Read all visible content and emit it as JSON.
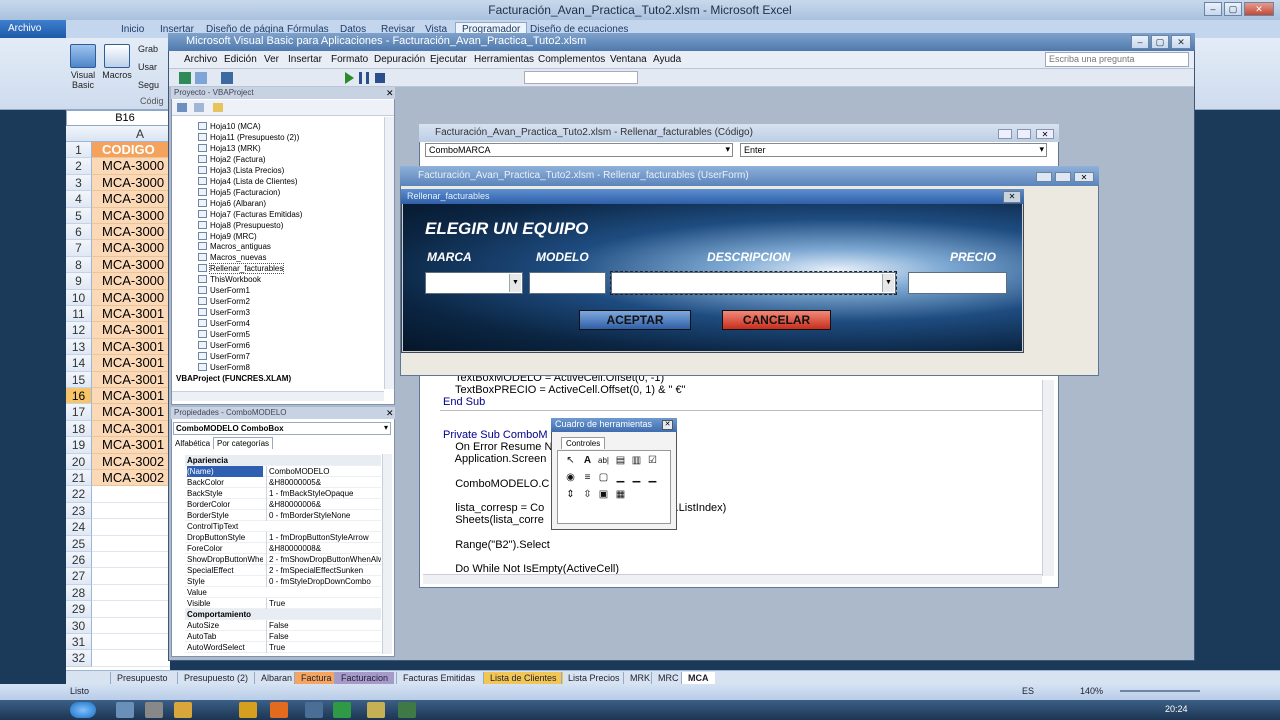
{
  "excel": {
    "title": "Facturación_Avan_Practica_Tuto2.xlsm  -  Microsoft Excel",
    "archivo": "Archivo",
    "tabs": [
      "Inicio",
      "Insertar",
      "Diseño de página",
      "Fórmulas",
      "Datos",
      "Revisar",
      "Vista",
      "Programador",
      "Diseño de ecuaciones"
    ],
    "ribbon": {
      "visual_basic": "Visual Basic",
      "macros": "Macros",
      "grab": "Grab",
      "usar": "Usar",
      "segu": "Segu",
      "group": "Códig"
    },
    "namebox": "B16",
    "column": "A",
    "header_cell": "CODIGO",
    "cells": [
      "MCA-3000",
      "MCA-3000",
      "MCA-3000",
      "MCA-3000",
      "MCA-3000",
      "MCA-3000",
      "MCA-3000",
      "MCA-3000",
      "MCA-3000",
      "MCA-3001",
      "MCA-3001",
      "MCA-3001",
      "MCA-3001",
      "MCA-3001",
      "MCA-3001",
      "MCA-3001",
      "MCA-3001",
      "MCA-3001",
      "MCA-3002",
      "MCA-3002"
    ],
    "rows": [
      "1",
      "2",
      "3",
      "4",
      "5",
      "6",
      "7",
      "8",
      "9",
      "10",
      "11",
      "12",
      "13",
      "14",
      "15",
      "16",
      "17",
      "18",
      "19",
      "20",
      "21",
      "22",
      "23",
      "24",
      "25",
      "26",
      "27",
      "28",
      "29",
      "30",
      "31",
      "32"
    ],
    "sheet_tabs": [
      "Presupuesto",
      "Presupuesto (2)",
      "Albaran",
      "Factura",
      "Facturacion",
      "Facturas Emitidas",
      "Lista de Clientes",
      "Lista Precios",
      "MRK",
      "MRC",
      "MCA"
    ],
    "status": "Listo",
    "zoom": "140%",
    "lang": "ES",
    "time": "20:24"
  },
  "vbe": {
    "title": "Microsoft Visual Basic para Aplicaciones - Facturación_Avan_Practica_Tuto2.xlsm",
    "menu": [
      "Archivo",
      "Edición",
      "Ver",
      "Insertar",
      "Formato",
      "Depuración",
      "Ejecutar",
      "Herramientas",
      "Complementos",
      "Ventana",
      "Ayuda"
    ],
    "ask_placeholder": "Escriba una pregunta",
    "project": {
      "title": "Proyecto - VBAProject",
      "items": [
        "Hoja10 (MCA)",
        "Hoja11 (Presupuesto (2))",
        "Hoja13 (MRK)",
        "Hoja2 (Factura)",
        "Hoja3 (Lista Precios)",
        "Hoja4 (Lista de Clientes)",
        "Hoja5 (Facturacion)",
        "Hoja6 (Albaran)",
        "Hoja7 (Facturas Emitidas)",
        "Hoja8 (Presupuesto)",
        "Hoja9 (MRC)",
        "Macros_antiguas",
        "Macros_nuevas",
        "Rellenar_facturables",
        "ThisWorkbook",
        "UserForm1",
        "UserForm2",
        "UserForm3",
        "UserForm4",
        "UserForm5",
        "UserForm6",
        "UserForm7",
        "UserForm8"
      ],
      "root": "VBAProject (FUNCRES.XLAM)"
    },
    "properties": {
      "title": "Propiedades - ComboMODELO",
      "object": "ComboMODELO ComboBox",
      "tab_alpha": "Alfabética",
      "tab_cat": "Por categorías",
      "cat1": "Apariencia",
      "rows1": [
        [
          "(Name)",
          "ComboMODELO"
        ],
        [
          "BackColor",
          "&H80000005&"
        ],
        [
          "BackStyle",
          "1 - fmBackStyleOpaque"
        ],
        [
          "BorderColor",
          "&H80000006&"
        ],
        [
          "BorderStyle",
          "0 - fmBorderStyleNone"
        ],
        [
          "ControlTipText",
          ""
        ],
        [
          "DropButtonStyle",
          "1 - fmDropButtonStyleArrow"
        ],
        [
          "ForeColor",
          "&H80000008&"
        ],
        [
          "ShowDropButtonWhen",
          "2 - fmShowDropButtonWhenAlways"
        ],
        [
          "SpecialEffect",
          "2 - fmSpecialEffectSunken"
        ],
        [
          "Style",
          "0 - fmStyleDropDownCombo"
        ],
        [
          "Value",
          ""
        ],
        [
          "Visible",
          "True"
        ]
      ],
      "cat2": "Comportamiento",
      "rows2": [
        [
          "AutoSize",
          "False"
        ],
        [
          "AutoTab",
          "False"
        ],
        [
          "AutoWordSelect",
          "True"
        ]
      ]
    },
    "code": {
      "title": "Facturación_Avan_Practica_Tuto2.xlsm - Rellenar_facturables (Código)",
      "object": "ComboMARCA",
      "proc": "Enter",
      "lines": [
        "    TextBoxMODELO = ActiveCell.Offset(0, -1)",
        "    TextBoxPRECIO = ActiveCell.Offset(0, 1) & \" €\"",
        "End Sub",
        "",
        "Private Sub ComboM",
        "    On Error Resume N",
        "    Application.Screen",
        "",
        "    ComboMODELO.C",
        "",
        "    lista_corresp = Co                              MARCA.ListIndex)",
        "    Sheets(lista_corre",
        "",
        "    Range(\"B2\").Select",
        "",
        "    Do While Not IsEmpty(ActiveCell)"
      ]
    },
    "userform": {
      "window_title": "Facturación_Avan_Practica_Tuto2.xlsm - Rellenar_facturables (UserForm)",
      "caption": "Rellenar_facturables",
      "heading": "ELEGIR UN EQUIPO",
      "labels": {
        "marca": "MARCA",
        "modelo": "MODELO",
        "descripcion": "DESCRIPCION",
        "precio": "PRECIO"
      },
      "accept": "ACEPTAR",
      "cancel": "CANCELAR"
    },
    "toolbox": {
      "title": "Cuadro de herramientas",
      "tab": "Controles"
    }
  }
}
